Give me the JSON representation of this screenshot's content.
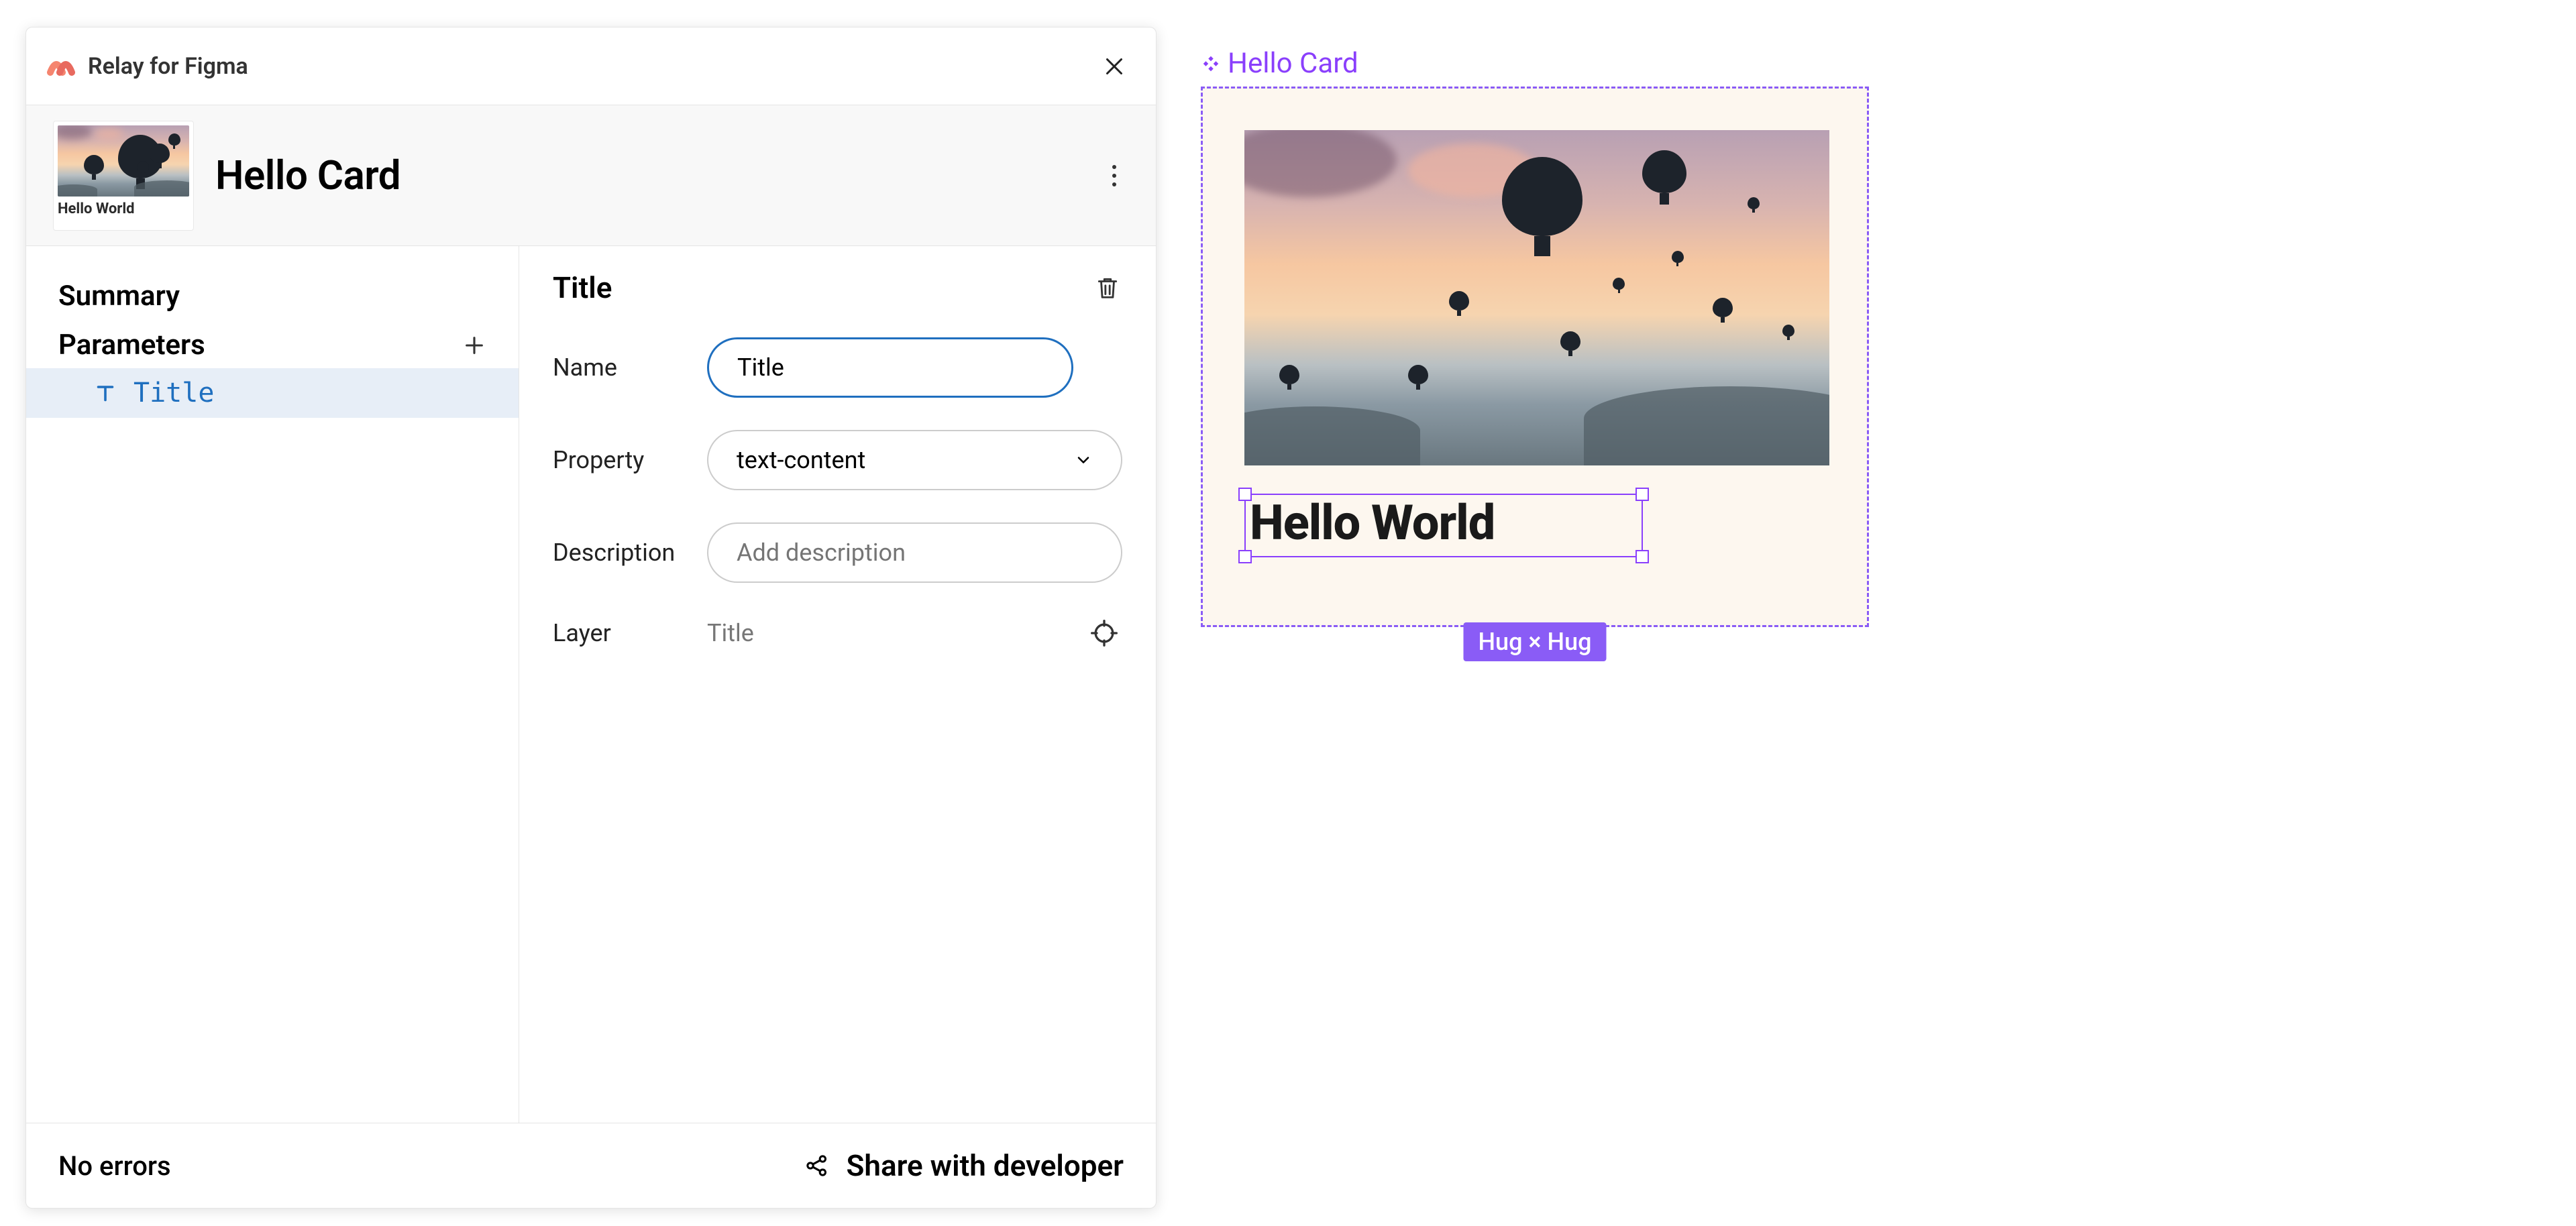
{
  "app": {
    "name": "Relay for Figma"
  },
  "card": {
    "title": "Hello Card",
    "thumb_caption": "Hello World"
  },
  "sidebar": {
    "summary_label": "Summary",
    "parameters_label": "Parameters",
    "items": [
      {
        "label": "Title"
      }
    ]
  },
  "detail": {
    "heading": "Title",
    "name_label": "Name",
    "name_value": "Title",
    "property_label": "Property",
    "property_value": "text-content",
    "description_label": "Description",
    "description_placeholder": "Add description",
    "layer_label": "Layer",
    "layer_value": "Title"
  },
  "footer": {
    "status": "No errors",
    "share_label": "Share with developer"
  },
  "canvas": {
    "component_name": "Hello Card",
    "text_content": "Hello World",
    "resize_tag": "Hug × Hug"
  }
}
